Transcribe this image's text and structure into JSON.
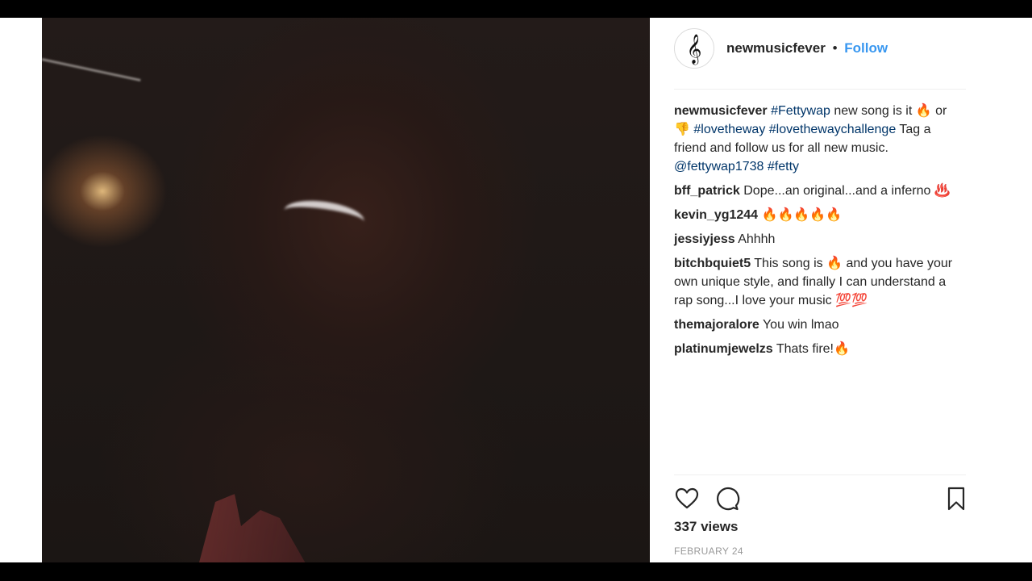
{
  "post": {
    "username": "newmusicfever",
    "separator": "•",
    "follow_label": "Follow",
    "caption": [
      {
        "t": "newmusicfever",
        "k": "user"
      },
      {
        "t": " ",
        "k": "text"
      },
      {
        "t": "#Fettywap",
        "k": "tag"
      },
      {
        "t": " new song is it 🔥 or 👎 ",
        "k": "text"
      },
      {
        "t": "#lovetheway",
        "k": "tag"
      },
      {
        "t": " ",
        "k": "text"
      },
      {
        "t": "#lovethewaychallenge",
        "k": "tag"
      },
      {
        "t": " Tag a friend and follow us for all new music. ",
        "k": "text"
      },
      {
        "t": "@fettywap1738",
        "k": "tag"
      },
      {
        "t": " ",
        "k": "text"
      },
      {
        "t": "#fetty",
        "k": "tag"
      }
    ],
    "comments": [
      {
        "user": "bff_patrick",
        "text": "Dope...an original...and a inferno ♨️"
      },
      {
        "user": "kevin_yg1244",
        "text": "🔥🔥🔥🔥🔥"
      },
      {
        "user": "jessiyjess",
        "text": "Ahhhh"
      },
      {
        "user": "bitchbquiet5",
        "text": "This song is 🔥 and you have your own unique style, and finally I can understand a rap song...I love your music 💯💯"
      },
      {
        "user": "themajoralore",
        "text": "You win lmao"
      },
      {
        "user": "platinumjewelzs",
        "text": "Thats fire!🔥"
      }
    ],
    "views": "337 views",
    "date": "FEBRUARY 24",
    "icons": {
      "avatar": "treble-clef-icon",
      "like": "heart-icon",
      "comment": "comment-bubble-icon",
      "save": "bookmark-icon"
    },
    "colors": {
      "follow": "#3897f0",
      "hashtag": "#003569",
      "text": "#262626",
      "muted": "#999999"
    }
  }
}
